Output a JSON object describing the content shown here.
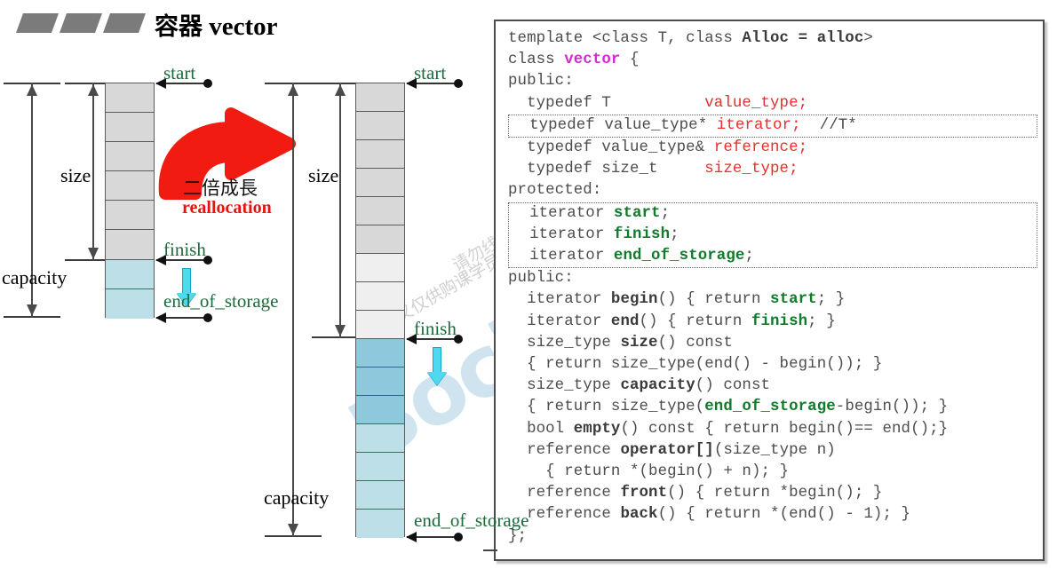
{
  "title": {
    "cn": "容器",
    "en": "vector"
  },
  "diagram": {
    "left": {
      "labels": {
        "start": "start",
        "finish": "finish",
        "end_of_storage": "end_of_storage",
        "size": "size",
        "capacity": "capacity"
      },
      "cells": [
        {
          "fill": "gray"
        },
        {
          "fill": "gray"
        },
        {
          "fill": "gray"
        },
        {
          "fill": "gray"
        },
        {
          "fill": "gray"
        },
        {
          "fill": "gray"
        },
        {
          "fill": "cyan"
        },
        {
          "fill": "cyan"
        }
      ],
      "size_cells": 6,
      "capacity_cells": 8
    },
    "right": {
      "labels": {
        "start": "start",
        "finish": "finish",
        "end_of_storage": "end_of_storage",
        "size": "size",
        "capacity": "capacity"
      },
      "cells": [
        {
          "fill": "gray"
        },
        {
          "fill": "gray"
        },
        {
          "fill": "gray"
        },
        {
          "fill": "gray"
        },
        {
          "fill": "gray"
        },
        {
          "fill": "gray"
        },
        {
          "fill": "lightgray"
        },
        {
          "fill": "lightgray"
        },
        {
          "fill": "lightgray"
        },
        {
          "fill": "cyan-dark"
        },
        {
          "fill": "cyan-dark"
        },
        {
          "fill": "cyan-dark"
        },
        {
          "fill": "cyan"
        },
        {
          "fill": "cyan"
        },
        {
          "fill": "cyan"
        },
        {
          "fill": "cyan"
        }
      ],
      "size_cells": 9,
      "capacity_cells": 16
    },
    "reallocation": {
      "cn": "二倍成長",
      "en": "reallocation"
    }
  },
  "colors": {
    "label_green": "#1c6b3c",
    "red": "#e8120e",
    "cyan": "#bde0e8",
    "cyan_dark": "#8ec8dc",
    "gray_cell": "#d8d8d8",
    "lightgray_cell": "#efefef",
    "type_red": "#ef2b2b",
    "member_green": "#127a2b",
    "vector_magenta": "#d42ad4"
  },
  "code": {
    "lines": [
      "template <class T, class Alloc = alloc>",
      "class vector {",
      "public:",
      "  typedef T          value_type;",
      "  typedef value_type* iterator;  //T*",
      "  typedef value_type& reference;",
      "  typedef size_t     size_type;",
      "protected:",
      "  iterator start;",
      "  iterator finish;",
      "  iterator end_of_storage;",
      "public:",
      "  iterator begin() { return start; }",
      "  iterator end() { return finish; }",
      "  size_type size() const",
      "  { return size_type(end() - begin()); }",
      "  size_type capacity() const",
      "  { return size_type(end_of_storage-begin()); }",
      "  bool empty() const { return begin()== end();}",
      "  reference operator[](size_type n)",
      "    { return *(begin() + n); }",
      "  reference front() { return *begin(); }",
      "  reference back() { return *(end() - 1); }",
      "};"
    ],
    "tokens": {
      "template": "template",
      "class": "class",
      "T": "T",
      "Alloc": "Alloc",
      "alloc": "alloc",
      "vector": "vector",
      "public": "public:",
      "protected": "protected:",
      "typedef": "typedef",
      "value_type": "value_type",
      "iterator": "iterator",
      "reference": "reference",
      "size_t": "size_t",
      "size_type": "size_type",
      "start": "start",
      "finish": "finish",
      "end_of_storage": "end_of_storage",
      "begin": "begin",
      "end": "end",
      "size": "size",
      "capacity": "capacity",
      "empty": "empty",
      "operator": "operator[]",
      "front": "front",
      "back": "back",
      "comment_tstar": "//T*",
      "const": "const",
      "bool": "bool",
      "n": "n"
    }
  },
  "watermark": {
    "word": "Bocian",
    "line1": "本讲义仅供购课学员专用",
    "line2": "请勿线上传播，侵害老师的知识版权"
  }
}
